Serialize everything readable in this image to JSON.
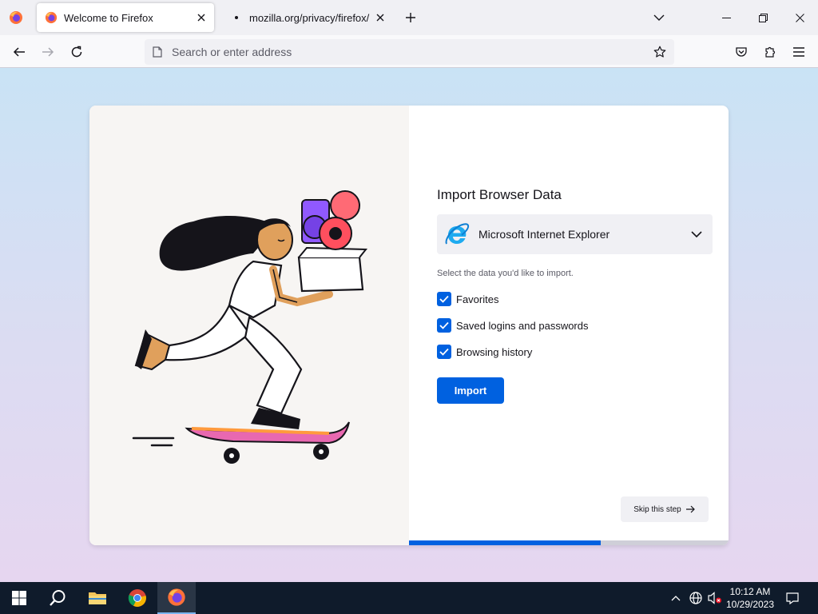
{
  "tabs": [
    {
      "title": "Welcome to Firefox",
      "active": true
    },
    {
      "title": "mozilla.org/privacy/firefox/",
      "active": false
    }
  ],
  "navbar": {
    "address_placeholder": "Search or enter address"
  },
  "import": {
    "title": "Import Browser Data",
    "selected_browser": "Microsoft Internet Explorer",
    "instruction": "Select the data you'd like to import.",
    "options": [
      {
        "label": "Favorites",
        "checked": true
      },
      {
        "label": "Saved logins and passwords",
        "checked": true
      },
      {
        "label": "Browsing history",
        "checked": true
      }
    ],
    "import_label": "Import",
    "skip_label": "Skip this step",
    "progress": 0.6
  },
  "taskbar": {
    "time": "10:12 AM",
    "date": "10/29/2023"
  },
  "colors": {
    "accent": "#0061e0",
    "taskbar": "#0f1b2b"
  }
}
